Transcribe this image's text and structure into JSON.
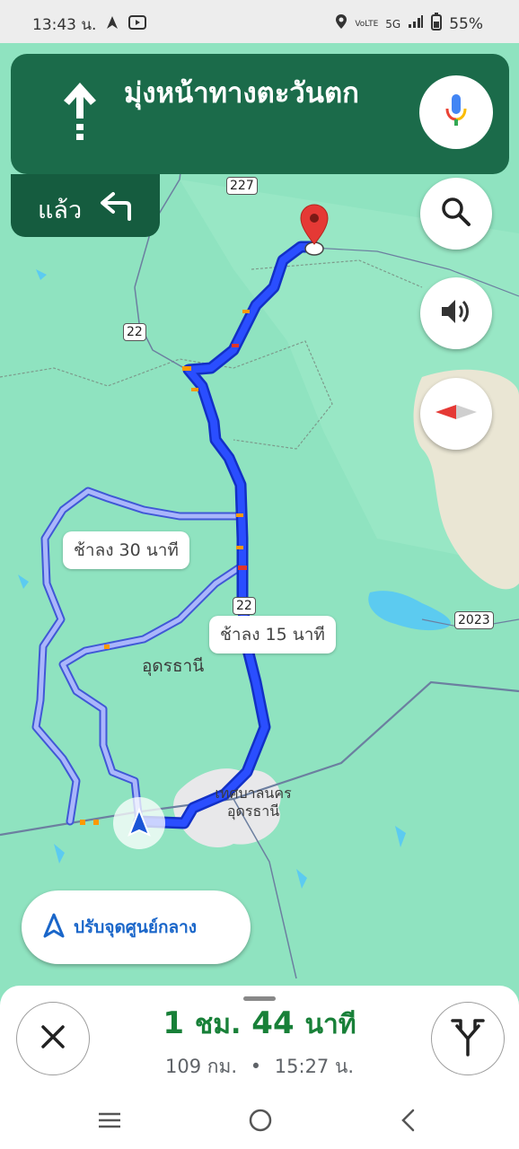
{
  "status_bar": {
    "time": "13:43 น.",
    "battery": "55%",
    "network": "5G",
    "volte": "VoLTE"
  },
  "navigation": {
    "instruction": "มุ่งหน้าทางตะวันตก",
    "then_label": "แล้ว"
  },
  "map": {
    "route_bubbles": [
      {
        "text": "ช้าลง 30 นาที"
      },
      {
        "text": "ช้าลง 15 นาที"
      }
    ],
    "labels": {
      "city": "อุดรธานี",
      "municipality": "เทศบาลนคร อุดรธานี"
    },
    "road_shields": {
      "r227": "227",
      "r22_north": "22",
      "r22_mid": "22",
      "r2023": "2023"
    },
    "colors": {
      "land": "#8fe3c0",
      "route_main": "#1a42ff",
      "route_alt": "#a8b4f7",
      "nav_header": "#1b6b4a",
      "water": "#5ccbf0",
      "urban": "#e8e8ea",
      "sand": "#eae6d4"
    }
  },
  "recenter": {
    "label": "ปรับจุดศูนย์กลาง"
  },
  "trip": {
    "eta_hours": "1",
    "eta_hours_unit": "ชม.",
    "eta_minutes": "44",
    "eta_minutes_unit": "นาที",
    "distance": "109 กม.",
    "separator": "•",
    "arrival": "15:27 น."
  },
  "icons": {
    "top_arrow": "straight-up-arrow-icon",
    "then": "turn-left-icon",
    "mic": "microphone-icon",
    "search": "search-icon",
    "sound": "speaker-icon",
    "compass": "compass-icon",
    "close": "close-icon",
    "alternates": "route-fork-icon"
  }
}
